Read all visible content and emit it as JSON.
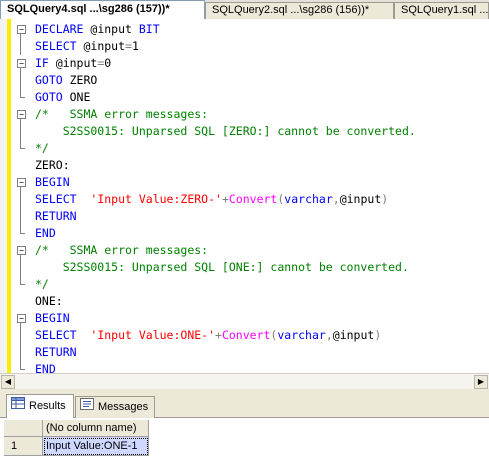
{
  "tabs": [
    {
      "label": "SQLQuery4.sql ...\\sg286 (157))*",
      "active": true
    },
    {
      "label": "SQLQuery2.sql ...\\sg286 (156))*",
      "active": false
    },
    {
      "label": "SQLQuery1.sql ...",
      "active": false
    }
  ],
  "code": [
    {
      "fold": "open",
      "segs": [
        [
          "kw",
          "DECLARE "
        ],
        [
          "bk",
          "@input "
        ],
        [
          "kw",
          "BIT"
        ]
      ]
    },
    {
      "fold": "none",
      "segs": [
        [
          "kw",
          "SELECT "
        ],
        [
          "bk",
          "@input"
        ],
        [
          "gr",
          "="
        ],
        [
          "bk",
          "1"
        ]
      ]
    },
    {
      "fold": "open",
      "segs": [
        [
          "kw",
          "IF "
        ],
        [
          "bk",
          "@input"
        ],
        [
          "gr",
          "="
        ],
        [
          "bk",
          "0"
        ]
      ]
    },
    {
      "fold": "none",
      "segs": [
        [
          "kw",
          "GOTO "
        ],
        [
          "bk",
          "ZERO"
        ]
      ]
    },
    {
      "fold": "end",
      "segs": [
        [
          "kw",
          "GOTO "
        ],
        [
          "bk",
          "ONE"
        ]
      ]
    },
    {
      "fold": "open",
      "segs": [
        [
          "cm",
          "/*   SSMA error messages:"
        ]
      ]
    },
    {
      "fold": "none",
      "segs": [
        [
          "cm",
          "    S2SS0015: Unparsed SQL [ZERO:] cannot be converted."
        ]
      ]
    },
    {
      "fold": "end",
      "segs": [
        [
          "cm",
          "*/"
        ]
      ]
    },
    {
      "fold": "none",
      "segs": [
        [
          "bk",
          "ZERO:"
        ]
      ]
    },
    {
      "fold": "open",
      "segs": [
        [
          "kw",
          "BEGIN"
        ]
      ]
    },
    {
      "fold": "none",
      "segs": [
        [
          "kw",
          "SELECT  "
        ],
        [
          "str",
          "'Input Value:ZERO-'"
        ],
        [
          "gr",
          "+"
        ],
        [
          "fn",
          "Convert"
        ],
        [
          "gr",
          "("
        ],
        [
          "kw",
          "varchar"
        ],
        [
          "gr",
          ","
        ],
        [
          "bk",
          "@input"
        ],
        [
          "gr",
          ")"
        ]
      ]
    },
    {
      "fold": "none",
      "segs": [
        [
          "kw",
          "RETURN"
        ]
      ]
    },
    {
      "fold": "end",
      "segs": [
        [
          "kw",
          "END"
        ]
      ]
    },
    {
      "fold": "open",
      "segs": [
        [
          "cm",
          "/*   SSMA error messages:"
        ]
      ]
    },
    {
      "fold": "none",
      "segs": [
        [
          "cm",
          "    S2SS0015: Unparsed SQL [ONE:] cannot be converted."
        ]
      ]
    },
    {
      "fold": "end",
      "segs": [
        [
          "cm",
          "*/"
        ]
      ]
    },
    {
      "fold": "none",
      "segs": [
        [
          "bk",
          "ONE:"
        ]
      ]
    },
    {
      "fold": "open",
      "segs": [
        [
          "kw",
          "BEGIN"
        ]
      ]
    },
    {
      "fold": "none",
      "segs": [
        [
          "kw",
          "SELECT  "
        ],
        [
          "str",
          "'Input Value:ONE-'"
        ],
        [
          "gr",
          "+"
        ],
        [
          "fn",
          "Convert"
        ],
        [
          "gr",
          "("
        ],
        [
          "kw",
          "varchar"
        ],
        [
          "gr",
          ","
        ],
        [
          "bk",
          "@input"
        ],
        [
          "gr",
          ")"
        ]
      ]
    },
    {
      "fold": "none",
      "segs": [
        [
          "kw",
          "RETURN"
        ]
      ]
    },
    {
      "fold": "end",
      "segs": [
        [
          "kw",
          "END"
        ]
      ]
    }
  ],
  "colors": {
    "keyword": "#0000ff",
    "comment": "#008000",
    "string": "#ff0000",
    "function": "#ff00ff",
    "operator": "#808080",
    "change_bar": "#ffed00"
  },
  "results_tabs": [
    {
      "label": "Results",
      "icon": "results-grid-icon",
      "active": true
    },
    {
      "label": "Messages",
      "icon": "messages-icon",
      "active": false
    }
  ],
  "grid": {
    "columns": [
      "(No column name)"
    ],
    "rows": [
      {
        "num": "1",
        "cells": [
          "Input Value:ONE-1"
        ]
      }
    ]
  }
}
